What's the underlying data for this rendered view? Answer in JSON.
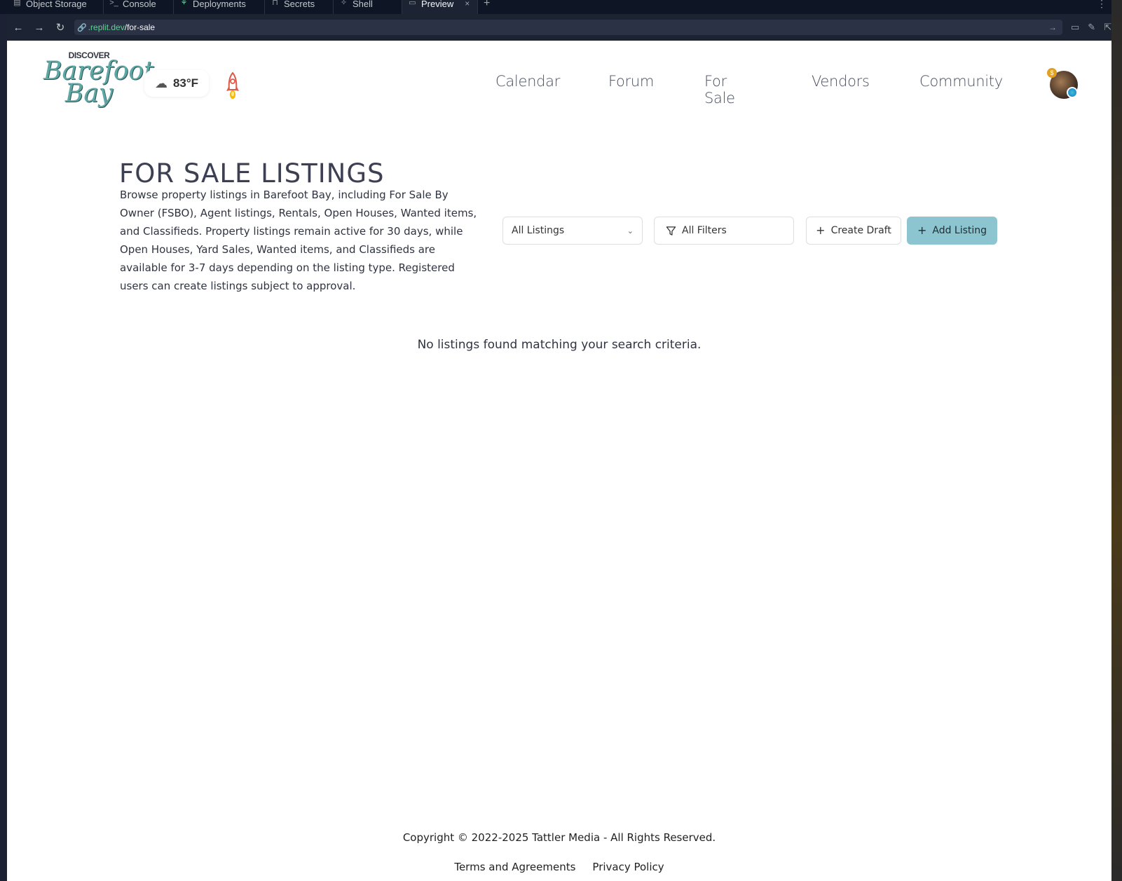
{
  "shell": {
    "tabs": [
      {
        "label": "Object Storage",
        "icon": "storage-icon"
      },
      {
        "label": "Console",
        "icon": "terminal-icon"
      },
      {
        "label": "Deployments",
        "icon": "deploy-icon"
      },
      {
        "label": "Secrets",
        "icon": "lock-icon"
      },
      {
        "label": "Shell",
        "icon": "shell-icon"
      },
      {
        "label": "Preview",
        "icon": "monitor-icon",
        "active": true
      }
    ],
    "url": {
      "host": ".replit.dev",
      "path": "/for-sale"
    }
  },
  "header": {
    "logo": {
      "top": "DISCOVER",
      "line1": "Barefoot",
      "line2": "Bay"
    },
    "weather": {
      "temp": "83°F",
      "icon": "cloud-icon"
    },
    "nav": [
      "Calendar",
      "Forum",
      "For Sale",
      "Vendors",
      "Community"
    ],
    "avatar": {
      "coin_badge": "$"
    }
  },
  "main": {
    "title": "FOR SALE LISTINGS",
    "description": "Browse property listings in Barefoot Bay, including For Sale By Owner (FSBO), Agent listings, Rentals, Open Houses, Wanted items, and Classifieds. Property listings remain active for 30 days, while Open Houses, Yard Sales, Wanted items, and Classifieds are available for 3-7 days depending on the listing type. Registered users can create listings subject to approval.",
    "listing_type_select": "All Listings",
    "filters_label": "All Filters",
    "create_draft_label": "Create Draft",
    "add_listing_label": "Add Listing",
    "empty_message": "No listings found matching your search criteria."
  },
  "footer": {
    "copyright": "Copyright © 2022-2025 Tattler Media - All Rights Reserved.",
    "links": [
      "Terms and Agreements",
      "Privacy Policy"
    ]
  },
  "colors": {
    "accent": "#8cc4cf",
    "logo_teal": "#5fa7a4",
    "shell_bg": "#0e1525"
  }
}
